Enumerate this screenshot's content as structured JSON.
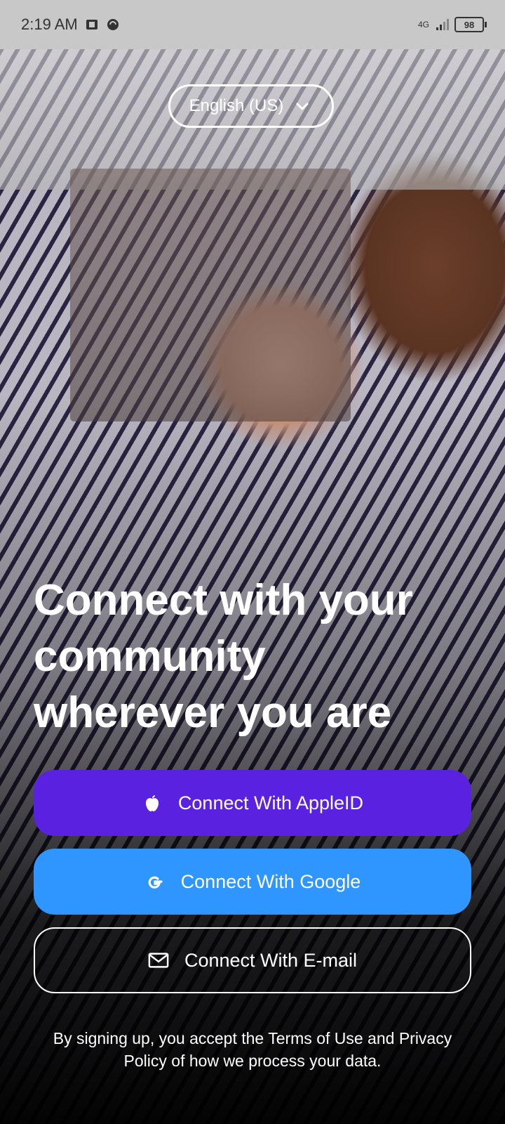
{
  "status_bar": {
    "time": "2:19 AM",
    "network": "4G",
    "battery": "98"
  },
  "language": {
    "label": "English (US)"
  },
  "headline": {
    "line1": "Connect with your",
    "line2": "community",
    "line3": "wherever you are"
  },
  "buttons": {
    "apple": "Connect With AppleID",
    "google": "Connect With Google",
    "email": "Connect With E-mail"
  },
  "legal": {
    "text": "By signing up, you accept the Terms of Use and Privacy Policy of how we process your data."
  },
  "colors": {
    "apple_button": "#5a22e0",
    "google_button": "#2f96ff"
  },
  "icons": {
    "language_dropdown": "chevron-down-icon",
    "apple": "apple-icon",
    "google": "google-icon",
    "email": "mail-icon"
  }
}
